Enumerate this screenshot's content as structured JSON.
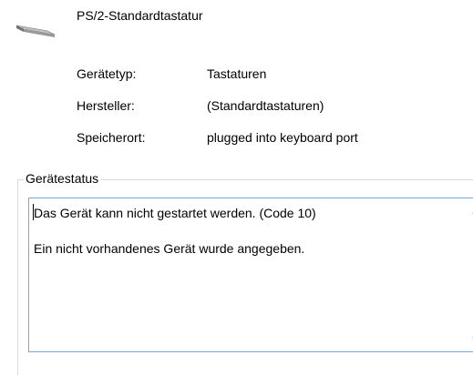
{
  "device": {
    "name": "PS/2-Standardtastatur",
    "icon": "keyboard-icon"
  },
  "properties": {
    "type_label": "Gerätetyp:",
    "type_value": "Tastaturen",
    "manufacturer_label": "Hersteller:",
    "manufacturer_value": "(Standardtastaturen)",
    "location_label": "Speicherort:",
    "location_value": "plugged into keyboard port"
  },
  "status": {
    "group_title": "Gerätestatus",
    "line1": "Das Gerät kann nicht gestartet werden. (Code 10)",
    "line2": "Ein nicht vorhandenes Gerät wurde angegeben."
  },
  "colors": {
    "status_border": "#7aa7d6",
    "group_border": "#dcdcdc"
  }
}
